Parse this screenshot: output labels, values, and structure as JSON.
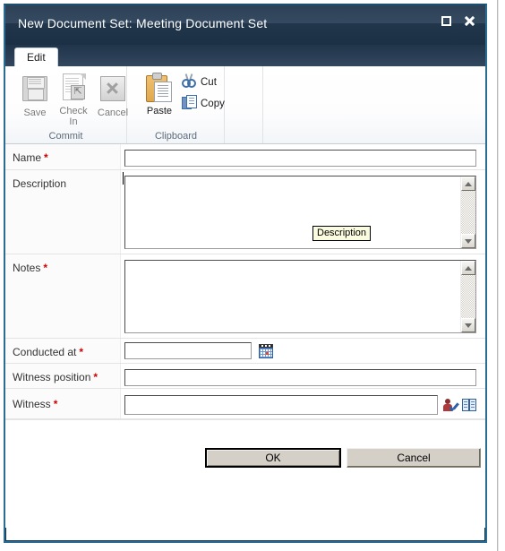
{
  "window": {
    "title": "New Document Set: Meeting Document Set",
    "restore_icon": "restore-icon",
    "close_icon": "close-icon"
  },
  "ribbon": {
    "tabs": [
      {
        "label": "Edit",
        "active": true
      }
    ],
    "groups": [
      {
        "name": "Commit",
        "buttons": [
          {
            "label": "Save",
            "icon": "floppy-disk-icon",
            "enabled": false
          },
          {
            "label": "Check In",
            "label_line1": "Check",
            "label_line2": "In",
            "icon": "page-checkin-icon",
            "enabled": false
          },
          {
            "label": "Cancel",
            "icon": "x-box-icon",
            "enabled": false
          }
        ]
      },
      {
        "name": "Clipboard",
        "buttons": [
          {
            "label": "Paste",
            "icon": "clipboard-icon",
            "enabled": true
          },
          {
            "label": "Cut",
            "icon": "scissors-icon",
            "enabled": true
          },
          {
            "label": "Copy",
            "icon": "copy-pages-icon",
            "enabled": true
          }
        ]
      }
    ]
  },
  "form": {
    "fields": [
      {
        "label": "Name",
        "required": true,
        "type": "text",
        "value": "",
        "placeholder": ""
      },
      {
        "label": "Description",
        "required": false,
        "type": "textarea",
        "value": "",
        "placeholder": ""
      },
      {
        "label": "Notes",
        "required": true,
        "type": "textarea",
        "value": "",
        "placeholder": ""
      },
      {
        "label": "Conducted at",
        "required": true,
        "type": "date",
        "value": "",
        "placeholder": "",
        "icon": "calendar-icon"
      },
      {
        "label": "Witness position",
        "required": true,
        "type": "text",
        "value": "",
        "placeholder": ""
      },
      {
        "label": "Witness",
        "required": true,
        "type": "people",
        "value": "",
        "placeholder": "",
        "icons": [
          "check-names-icon",
          "address-book-icon"
        ]
      }
    ],
    "required_marker": "*"
  },
  "tooltip": {
    "text": "Description"
  },
  "footer": {
    "ok_label": "OK",
    "cancel_label": "Cancel"
  },
  "colors": {
    "titlebar_dark": "#1b3045",
    "titlebar_light": "#354a60",
    "dialog_border": "#2a6c92",
    "required_red": "#d00000",
    "button_face": "#d4d0c8",
    "tooltip_bg": "#fbfbe0"
  }
}
